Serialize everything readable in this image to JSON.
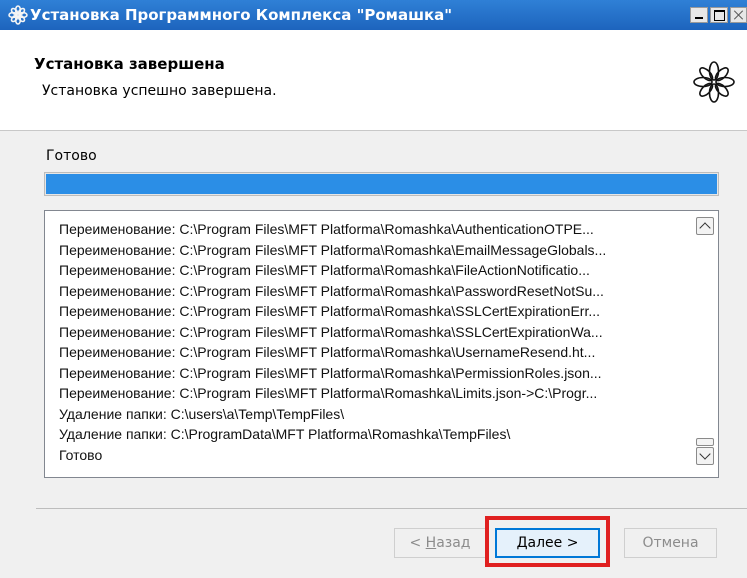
{
  "window": {
    "title": "Установка Программного Комплекса \"Ромашка\""
  },
  "header": {
    "title": "Установка завершена",
    "subtitle": "Установка успешно завершена.",
    "logo_icon": "flower-logo-icon"
  },
  "progress": {
    "label": "Готово",
    "fraction": 1.0,
    "color": "#2b8ee6"
  },
  "log": {
    "lines": [
      "Переименование: C:\\Program Files\\MFT Platforma\\Romashka\\AuthenticationOTPE...",
      "Переименование: C:\\Program Files\\MFT Platforma\\Romashka\\EmailMessageGlobals...",
      "Переименование: C:\\Program Files\\MFT Platforma\\Romashka\\FileActionNotificatio...",
      "Переименование: C:\\Program Files\\MFT Platforma\\Romashka\\PasswordResetNotSu...",
      "Переименование: C:\\Program Files\\MFT Platforma\\Romashka\\SSLCertExpirationErr...",
      "Переименование: C:\\Program Files\\MFT Platforma\\Romashka\\SSLCertExpirationWa...",
      "Переименование: C:\\Program Files\\MFT Platforma\\Romashka\\UsernameResend.ht...",
      "Переименование: C:\\Program Files\\MFT Platforma\\Romashka\\PermissionRoles.json...",
      "Переименование: C:\\Program Files\\MFT Platforma\\Romashka\\Limits.json->C:\\Progr...",
      "Удаление папки: C:\\users\\a\\Temp\\TempFiles\\",
      "Удаление папки: C:\\ProgramData\\MFT Platforma\\Romashka\\TempFiles\\",
      "Готово"
    ]
  },
  "buttons": {
    "back_prefix": "< ",
    "back_accel": "Н",
    "back_rest": "азад",
    "next_accel": "Д",
    "next_rest": "алее >",
    "cancel": "Отмена"
  },
  "highlight_color": "#e02020"
}
